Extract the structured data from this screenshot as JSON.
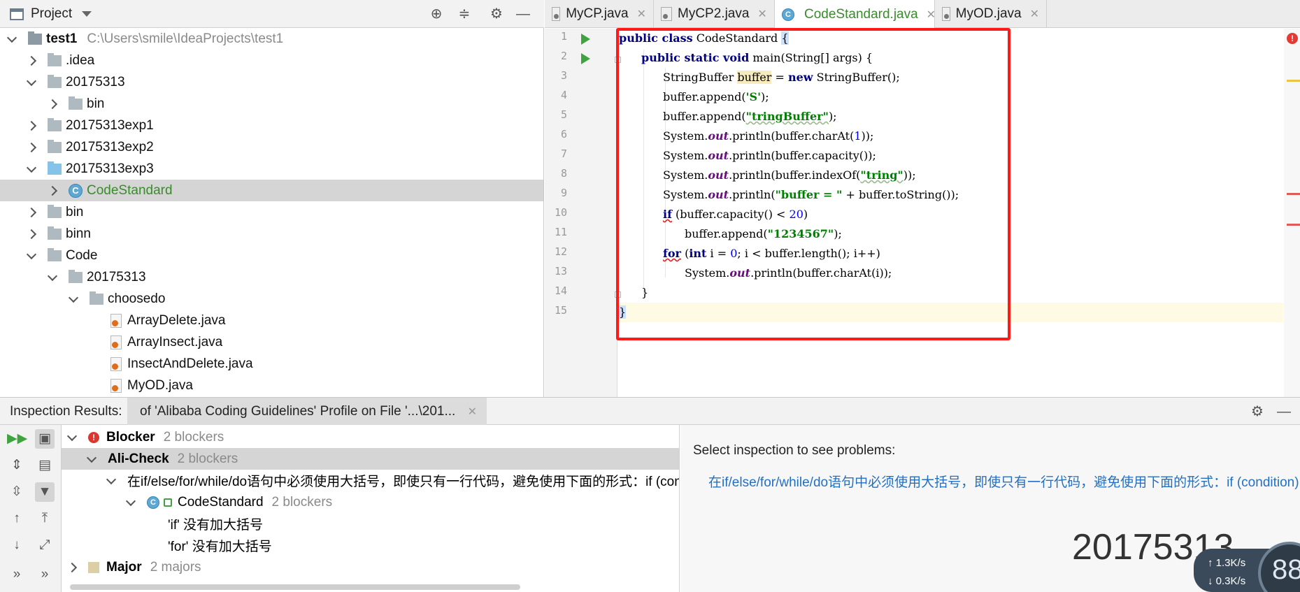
{
  "project_panel": {
    "title": "Project",
    "tree": [
      {
        "label": "test1",
        "path": "C:\\Users\\smile\\IdeaProjects\\test1"
      },
      {
        "label": ".idea"
      },
      {
        "label": "20175313"
      },
      {
        "label": "bin"
      },
      {
        "label": "20175313exp1"
      },
      {
        "label": "20175313exp2"
      },
      {
        "label": "20175313exp3"
      },
      {
        "label": "CodeStandard"
      },
      {
        "label": "bin"
      },
      {
        "label": "binn"
      },
      {
        "label": "Code"
      },
      {
        "label": "20175313"
      },
      {
        "label": "choosedo"
      },
      {
        "label": "ArrayDelete.java"
      },
      {
        "label": "ArrayInsect.java"
      },
      {
        "label": "InsectAndDelete.java"
      },
      {
        "label": "MyOD.java"
      }
    ]
  },
  "editor": {
    "tabs": [
      {
        "label": "MyCP.java"
      },
      {
        "label": "MyCP2.java"
      },
      {
        "label": "CodeStandard.java"
      },
      {
        "label": "MyOD.java"
      }
    ],
    "line_numbers": [
      "1",
      "2",
      "3",
      "4",
      "5",
      "6",
      "7",
      "8",
      "9",
      "10",
      "11",
      "12",
      "13",
      "14",
      "15"
    ],
    "code": {
      "l1_kw": "public class",
      "l1_name": " CodeStandard ",
      "l1_brace": "{",
      "l2_kw": "public static void",
      "l2_rest": " main(String[] args) {",
      "l3_a": "StringBuffer ",
      "l3_var": "buffer",
      "l3_b": " = ",
      "l3_kw": "new",
      "l3_c": " StringBuffer();",
      "l4_a": "buffer.append(",
      "l4_str": "'S'",
      "l4_b": ");",
      "l5_a": "buffer.append(",
      "l5_str": "\"tringBuffer\"",
      "l5_b": ");",
      "sys": "System.",
      "out": "out",
      "l6_rest_a": ".println(buffer.charAt(",
      "l6_num": "1",
      "l6_rest_b": "));",
      "l7_rest": ".println(buffer.capacity());",
      "l8_rest_a": ".println(buffer.indexOf(",
      "l8_str": "\"tring\"",
      "l8_rest_b": "));",
      "l9_a": ".println(",
      "l9_str": "\"buffer = \"",
      "l9_b": " + buffer.toString());",
      "l10_kw": "if",
      "l10_a": " (buffer.capacity() < ",
      "l10_num": "20",
      "l10_b": ")",
      "l11_a": "buffer.append(",
      "l11_str": "\"1234567\"",
      "l11_b": ");",
      "l12_kw": "for",
      "l12_a": " (",
      "l12_kw2": "int",
      "l12_b": " i = ",
      "l12_num": "0",
      "l12_c": "; i < buffer.length(); i++)",
      "l13_a": ".println(buffer.charAt(i));",
      "l14": "}",
      "l15": "}"
    }
  },
  "inspection": {
    "title": "Inspection Results:",
    "tab_label": "of 'Alibaba Coding Guidelines' Profile on File '...\\201...",
    "tree": {
      "blocker_label": "Blocker",
      "blocker_count": "2 blockers",
      "alicheck_label": "Ali-Check",
      "alicheck_count": "2 blockers",
      "rule_text": "在if/else/for/while/do语句中必须使用大括号，即使只有一行代码，避免使用下面的形式：if (condition) statements;",
      "class_label": "CodeStandard",
      "class_count": "2 blockers",
      "issue_if": "'if' 没有加大括号",
      "issue_for": "'for' 没有加大括号",
      "major_label": "Major",
      "major_count": "2 majors"
    },
    "detail": {
      "title": "Select inspection to see problems:",
      "link": "在if/else/for/while/do语句中必须使用大括号，即使只有一行代码，避免使用下面的形式：if (condition)."
    }
  },
  "overlay": {
    "watermark": "20175313",
    "upload_speed": "1.3K/s",
    "download_speed": "0.3K/s",
    "gauge_value": "88"
  },
  "colors": {
    "annotation_frame": "#ff1a1a",
    "keyword": "#000080",
    "string": "#008000",
    "link": "#2370c2"
  }
}
